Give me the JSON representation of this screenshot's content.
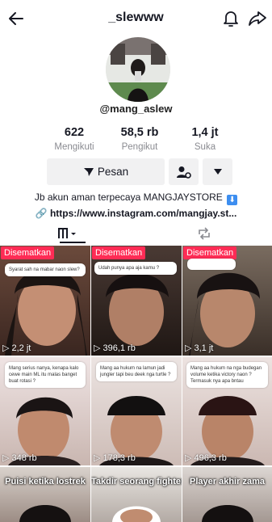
{
  "header": {
    "username": "_slewww"
  },
  "profile": {
    "handle": "@mang_aslew",
    "stats": [
      {
        "value": "622",
        "label": "Mengikuti"
      },
      {
        "value": "58,5 rb",
        "label": "Pengikut"
      },
      {
        "value": "1,4 jt",
        "label": "Suka"
      }
    ],
    "message_button": "Pesan",
    "bio": "Jb akun aman terpecaya MANGJAYSTORE",
    "link": "https://www.instagram.com/mangjay.st..."
  },
  "icons": {
    "back": "arrow-left-icon",
    "notifications": "bell-icon",
    "share": "share-arrow-icon",
    "videos_tab": "grid-icon",
    "reposts_tab": "repost-icon"
  },
  "colors": {
    "pinned_badge": "#fe2c55",
    "bio_badge": "#3d8ef0"
  },
  "videos": [
    {
      "pinned": "Disematkan",
      "views": "2,2 jt",
      "bubble": "Syarat sah na mabar naon slew?",
      "caption": ""
    },
    {
      "pinned": "Disematkan",
      "views": "396,1 rb",
      "bubble": "Udah punya apa aja kamu ?",
      "caption": ""
    },
    {
      "pinned": "Disematkan",
      "views": "3,1 jt",
      "bubble": "",
      "caption": ""
    },
    {
      "pinned": "",
      "views": "348 rb",
      "bubble": "Mang serius nanya, kenapa kalo cewe main ML itu malas banget buat rotasi ?",
      "caption": ""
    },
    {
      "pinned": "",
      "views": "178,3 rb",
      "bubble": "Mang aa hukum na lamun jadi jungler tapi beu deek nga turtle ?",
      "caption": ""
    },
    {
      "pinned": "",
      "views": "496,3 rb",
      "bubble": "Mang aa hukum na nga budegan volume ketika victory naon ? Termasuk nya apa bntau",
      "caption": ""
    },
    {
      "pinned": "",
      "views": "",
      "bubble": "",
      "caption": "Puisi ketika lostrek"
    },
    {
      "pinned": "",
      "views": "",
      "bubble": "",
      "caption": "Takdir seorang fighter"
    },
    {
      "pinned": "",
      "views": "",
      "bubble": "",
      "caption": "Player akhir zama"
    }
  ]
}
